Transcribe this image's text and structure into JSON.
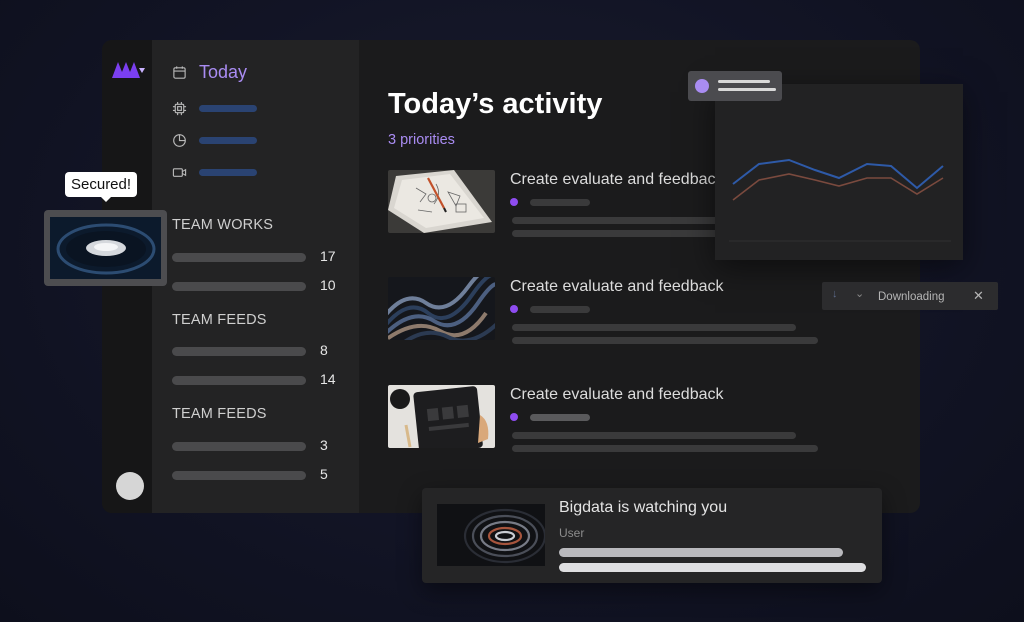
{
  "app": {
    "brand": "logo-icon"
  },
  "sidebar": {
    "today_label": "Today",
    "nav_icons": [
      "calendar-icon",
      "cpu-icon",
      "pie-chart-icon",
      "video-icon"
    ],
    "sections": [
      {
        "title": "TEAM WORKS",
        "counts": [
          "17",
          "10"
        ]
      },
      {
        "title": "TEAM FEEDS",
        "counts": [
          "8",
          "14"
        ]
      },
      {
        "title": "TEAM FEEDS",
        "counts": [
          "3",
          "5"
        ]
      }
    ]
  },
  "main": {
    "title": "Today’s activity",
    "subtitle": "3 priorities",
    "tasks": [
      {
        "title": "Create evaluate and feedback"
      },
      {
        "title": "Create evaluate and feedback"
      },
      {
        "title": "Create evaluate and feedback"
      }
    ]
  },
  "floating": {
    "secured_label": "Secured!",
    "download_label": "Downloading",
    "watch_title": "Bigdata is watching you",
    "watch_sub": "User"
  },
  "colors": {
    "accent": "#a98cf2",
    "dot": "#8e4cf0",
    "chart_line_blue": "#2e5aa8",
    "chart_line_brown": "#7a4a3e"
  }
}
